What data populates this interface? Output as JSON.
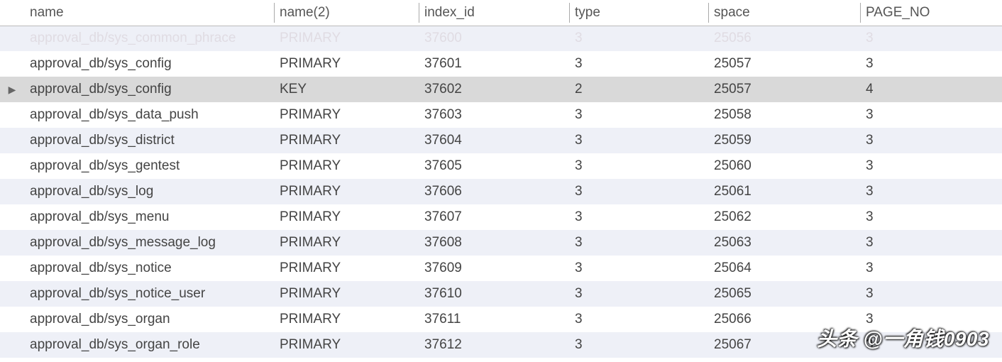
{
  "headers": {
    "name": "name",
    "name2": "name(2)",
    "index_id": "index_id",
    "type": "type",
    "space": "space",
    "page_no": "PAGE_NO"
  },
  "rows": [
    {
      "name": "approval_db/sys_common_phrace",
      "name2": "PRIMARY",
      "index_id": "37600",
      "type": "3",
      "space": "25056",
      "page_no": "3",
      "selected": false,
      "faded": true
    },
    {
      "name": "approval_db/sys_config",
      "name2": "PRIMARY",
      "index_id": "37601",
      "type": "3",
      "space": "25057",
      "page_no": "3",
      "selected": false,
      "faded": false
    },
    {
      "name": "approval_db/sys_config",
      "name2": "KEY",
      "index_id": "37602",
      "type": "2",
      "space": "25057",
      "page_no": "4",
      "selected": true,
      "faded": false
    },
    {
      "name": "approval_db/sys_data_push",
      "name2": "PRIMARY",
      "index_id": "37603",
      "type": "3",
      "space": "25058",
      "page_no": "3",
      "selected": false,
      "faded": false
    },
    {
      "name": "approval_db/sys_district",
      "name2": "PRIMARY",
      "index_id": "37604",
      "type": "3",
      "space": "25059",
      "page_no": "3",
      "selected": false,
      "faded": false
    },
    {
      "name": "approval_db/sys_gentest",
      "name2": "PRIMARY",
      "index_id": "37605",
      "type": "3",
      "space": "25060",
      "page_no": "3",
      "selected": false,
      "faded": false
    },
    {
      "name": "approval_db/sys_log",
      "name2": "PRIMARY",
      "index_id": "37606",
      "type": "3",
      "space": "25061",
      "page_no": "3",
      "selected": false,
      "faded": false
    },
    {
      "name": "approval_db/sys_menu",
      "name2": "PRIMARY",
      "index_id": "37607",
      "type": "3",
      "space": "25062",
      "page_no": "3",
      "selected": false,
      "faded": false
    },
    {
      "name": "approval_db/sys_message_log",
      "name2": "PRIMARY",
      "index_id": "37608",
      "type": "3",
      "space": "25063",
      "page_no": "3",
      "selected": false,
      "faded": false
    },
    {
      "name": "approval_db/sys_notice",
      "name2": "PRIMARY",
      "index_id": "37609",
      "type": "3",
      "space": "25064",
      "page_no": "3",
      "selected": false,
      "faded": false
    },
    {
      "name": "approval_db/sys_notice_user",
      "name2": "PRIMARY",
      "index_id": "37610",
      "type": "3",
      "space": "25065",
      "page_no": "3",
      "selected": false,
      "faded": false
    },
    {
      "name": "approval_db/sys_organ",
      "name2": "PRIMARY",
      "index_id": "37611",
      "type": "3",
      "space": "25066",
      "page_no": "3",
      "selected": false,
      "faded": false
    },
    {
      "name": "approval_db/sys_organ_role",
      "name2": "PRIMARY",
      "index_id": "37612",
      "type": "3",
      "space": "25067",
      "page_no": "3",
      "selected": false,
      "faded": false
    }
  ],
  "watermark": "头条 @一角钱0903",
  "selected_marker": "▶"
}
